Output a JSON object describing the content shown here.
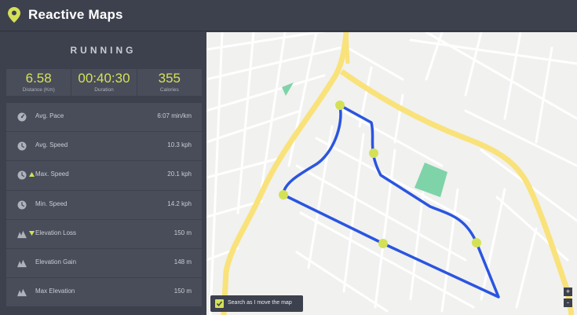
{
  "header": {
    "app_title": "Reactive Maps",
    "logo_icon": "map-pin-icon",
    "accent_color": "#d4e157"
  },
  "sidebar": {
    "activity": "RUNNING",
    "stats": [
      {
        "value": "6.58",
        "label": "Distance (Km)"
      },
      {
        "value": "00:40:30",
        "label": "Duration"
      },
      {
        "value": "355",
        "label": "Calories"
      }
    ],
    "metrics": [
      {
        "label": "Avg. Pace",
        "value": "6:07 min/km",
        "icon": "speedometer-icon"
      },
      {
        "label": "Avg. Speed",
        "value": "10.3 kph",
        "icon": "clock-icon"
      },
      {
        "label": "Max. Speed",
        "value": "20.1 kph",
        "icon": "clock-icon",
        "arrow": "up"
      },
      {
        "label": "Min. Speed",
        "value": "14.2 kph",
        "icon": "clock-icon"
      },
      {
        "label": "Elevation Loss",
        "value": "150 m",
        "icon": "mountain-icon",
        "arrow": "down"
      },
      {
        "label": "Elevation Gain",
        "value": "148 m",
        "icon": "mountain-icon"
      },
      {
        "label": "Max Elevation",
        "value": "150 m",
        "icon": "mountain-icon"
      }
    ]
  },
  "map": {
    "search_toggle_label": "Search as I move the map",
    "search_toggle_checked": true,
    "zoom_in_label": "+",
    "zoom_out_label": "-",
    "route_color": "#2a55e0",
    "highway_color": "#f9e27a",
    "park_color": "#7fd3a8",
    "marker_color": "#d4e157"
  }
}
